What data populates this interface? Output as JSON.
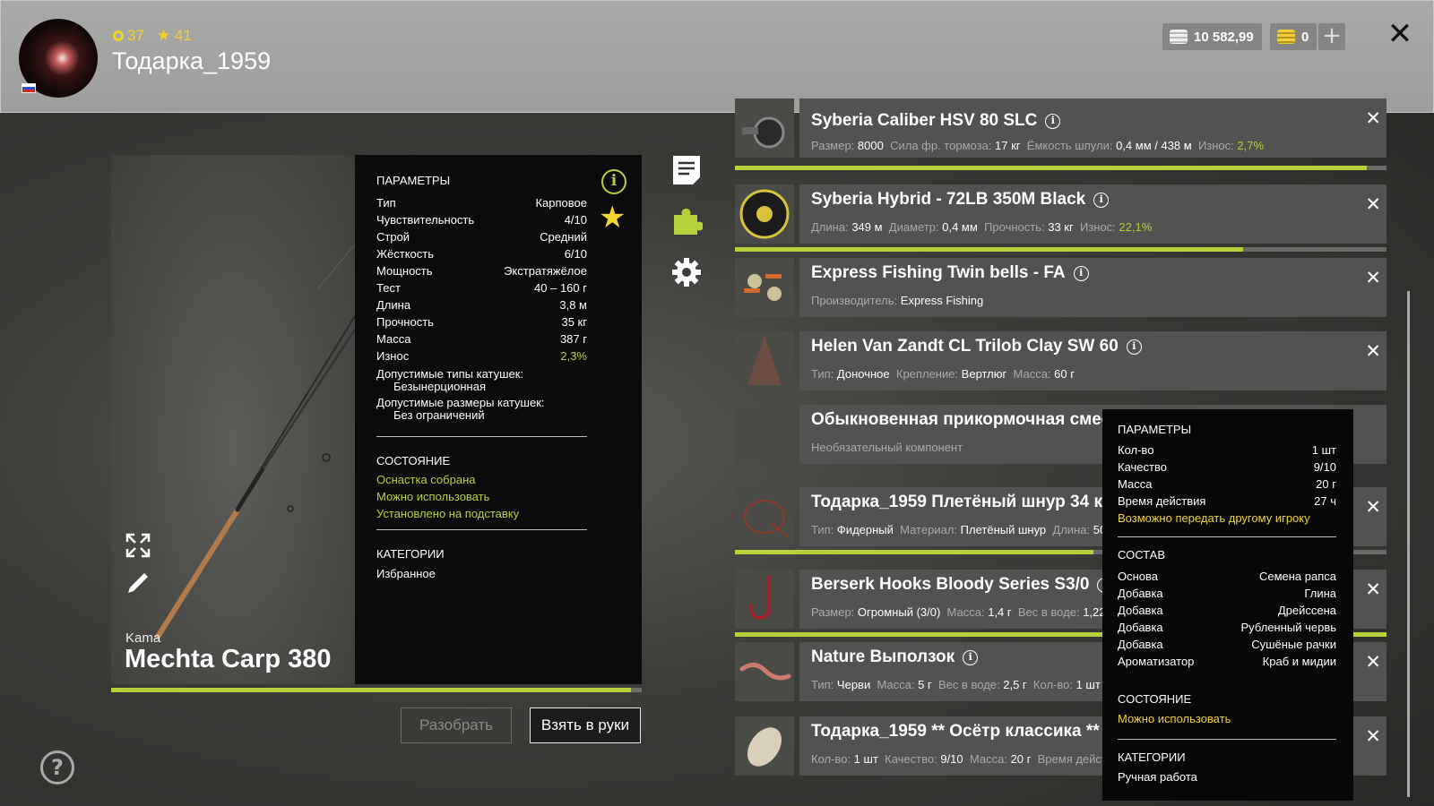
{
  "header": {
    "level": "37",
    "rating": "41",
    "player_name": "Тодарка_1959",
    "silver": "10 582,99",
    "gold": "0",
    "plus_label": "+",
    "close_label": "✕"
  },
  "rod": {
    "brand": "Kama",
    "name": "Mechta Carp 380",
    "wear_fraction": 0.98,
    "params_title": "ПАРАМЕТРЫ",
    "params": [
      {
        "label": "Тип",
        "value": "Карповое"
      },
      {
        "label": "Чувствительность",
        "value": "4/10"
      },
      {
        "label": "Строй",
        "value": "Средний"
      },
      {
        "label": "Жёсткость",
        "value": "6/10"
      },
      {
        "label": "Мощность",
        "value": "Экстратяжёлое"
      },
      {
        "label": "Тест",
        "value": "40 – 160 г"
      },
      {
        "label": "Длина",
        "value": "3,8 м"
      },
      {
        "label": "Прочность",
        "value": "35 кг"
      },
      {
        "label": "Масса",
        "value": "387 г"
      },
      {
        "label": "Износ",
        "value": "2,3%"
      }
    ],
    "reel_types_label": "Допустимые типы катушек:",
    "reel_types_value": "Безынерционная",
    "reel_sizes_label": "Допустимые размеры катушек:",
    "reel_sizes_value": "Без ограничений",
    "state_title": "СОСТОЯНИЕ",
    "states": [
      "Оснастка собрана",
      "Можно использовать",
      "Установлено на подставку"
    ],
    "categories_title": "КАТЕГОРИИ",
    "category": "Избранное",
    "btn_disassemble": "Разобрать",
    "btn_take": "Взять в руки"
  },
  "items": [
    {
      "title": "Syberia Caliber HSV 80 SLC",
      "sub": [
        [
          "Размер:",
          "8000"
        ],
        [
          "Сила фр. тормоза:",
          "17 кг"
        ],
        [
          "Ёмкость шпули:",
          "0,4 мм / 438 м"
        ],
        [
          "Износ:",
          "2,7%"
        ]
      ],
      "wear": 0.97
    },
    {
      "title": "Syberia Hybrid - 72LB 350M Black",
      "sub": [
        [
          "Длина:",
          "349 м"
        ],
        [
          "Диаметр:",
          "0,4 мм"
        ],
        [
          "Прочность:",
          "33 кг"
        ],
        [
          "Износ:",
          "22,1%"
        ]
      ],
      "wear": 0.78
    },
    {
      "title": "Express Fishing Twin bells - FA",
      "sub": [
        [
          "Производитель:",
          "Express Fishing"
        ]
      ]
    },
    {
      "title": "Helen Van Zandt CL Trilob Clay SW 60",
      "sub": [
        [
          "Тип:",
          "Доночное"
        ],
        [
          "Крепление:",
          "Вертлюг"
        ],
        [
          "Масса:",
          "60 г"
        ]
      ]
    },
    {
      "title": "Обыкновенная прикормочная смесь",
      "sub": [
        [
          "Необязательный компонент",
          ""
        ]
      ]
    },
    {
      "title": "Тодарка_1959 Плетёный шнур 34 кг",
      "sub": [
        [
          "Тип:",
          "Фидерный"
        ],
        [
          "Материал:",
          "Плетёный шнур"
        ],
        [
          "Длина:",
          "50"
        ]
      ],
      "wear": 0.55
    },
    {
      "title": "Berserk Hooks Bloody Series S3/0",
      "sub": [
        [
          "Размер:",
          "Огромный (3/0)"
        ],
        [
          "Масса:",
          "1,4 г"
        ],
        [
          "Вес в воде:",
          "1,22 г"
        ]
      ],
      "wear": 1.0
    },
    {
      "title": "Nature Выползок",
      "sub": [
        [
          "Тип:",
          "Черви"
        ],
        [
          "Масса:",
          "5 г"
        ],
        [
          "Вес в воде:",
          "2,5 г"
        ],
        [
          "Кол-во:",
          "1 шт"
        ]
      ]
    },
    {
      "title": "Тодарка_1959 ** Осётр классика **",
      "sub": [
        [
          "Кол-во:",
          "1 шт"
        ],
        [
          "Качество:",
          "9/10"
        ],
        [
          "Масса:",
          "20 г"
        ],
        [
          "Время действия",
          ""
        ]
      ]
    }
  ],
  "tooltip": {
    "params_title": "ПАРАМЕТРЫ",
    "params": [
      {
        "label": "Кол-во",
        "value": "1 шт"
      },
      {
        "label": "Качество",
        "value": "9/10"
      },
      {
        "label": "Масса",
        "value": "20 г"
      },
      {
        "label": "Время действия",
        "value": "27 ч"
      }
    ],
    "transfer_note": "Возможно передать другому игроку",
    "composition_title": "СОСТАВ",
    "composition": [
      {
        "label": "Основа",
        "value": "Семена рапса"
      },
      {
        "label": "Добавка",
        "value": "Глина"
      },
      {
        "label": "Добавка",
        "value": "Дрейссена"
      },
      {
        "label": "Добавка",
        "value": "Рубленный червь"
      },
      {
        "label": "Добавка",
        "value": "Сушёные рачки"
      },
      {
        "label": "Ароматизатор",
        "value": "Краб и мидии"
      }
    ],
    "state_title": "СОСТОЯНИЕ",
    "state": "Можно использовать",
    "categories_title": "КАТЕГОРИИ",
    "category": "Ручная работа"
  },
  "colors": {
    "accent": "#b6d23a",
    "gold": "#f0d22c"
  }
}
